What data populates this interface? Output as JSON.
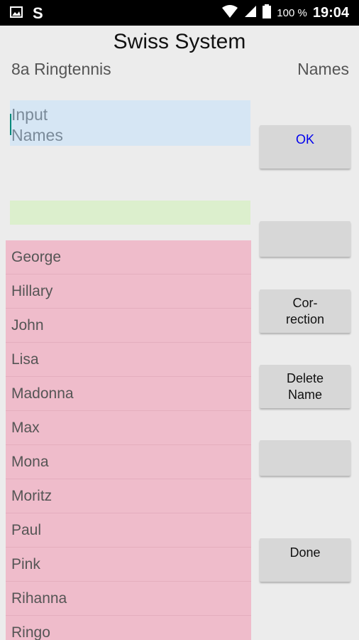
{
  "status_bar": {
    "battery": "100 %",
    "time": "19:04",
    "app_letter": "S",
    "icons": [
      "image-icon",
      "wifi-icon",
      "cellular-signal-icon",
      "battery-icon"
    ]
  },
  "header": {
    "title": "Swiss System",
    "tournament_name": "8a Ringtennis",
    "section_label": "Names"
  },
  "input": {
    "placeholder": "Input\nNames",
    "value": ""
  },
  "names": [
    "George",
    "Hillary",
    "John",
    "Lisa",
    "Madonna",
    "Max",
    "Mona",
    "Moritz",
    "Paul",
    "Pink",
    "Rihanna",
    "Ringo"
  ],
  "buttons": {
    "ok": "OK",
    "blank1": "",
    "correction_line1": "Cor-",
    "correction_line2": "rection",
    "delete_line1": "Delete",
    "delete_line2": "Name",
    "blank2": "",
    "done": "Done"
  },
  "colors": {
    "input_bg": "#d6e6f4",
    "secondary_bg": "#dcefcd",
    "list_bg": "#efbccb",
    "button_bg": "#d7d7d7",
    "ok_text": "#0000ee"
  }
}
